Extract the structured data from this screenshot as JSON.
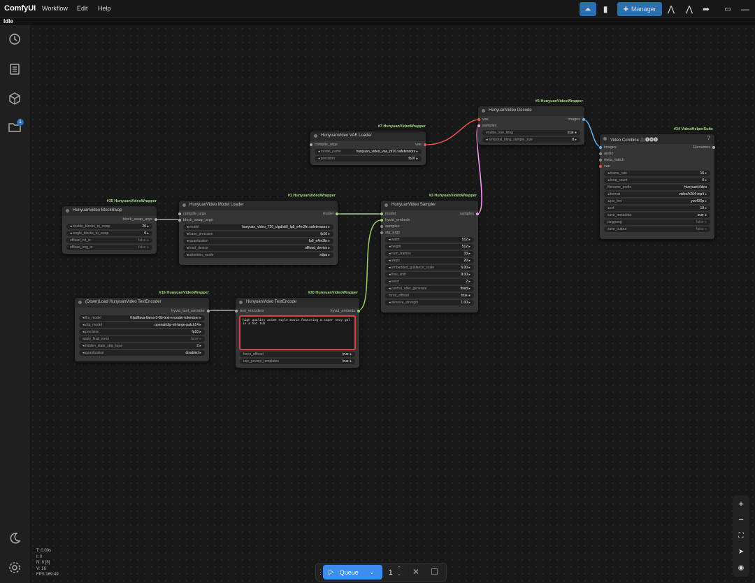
{
  "app": {
    "logo": "ComfyUI",
    "menu": [
      "Workflow",
      "Edit",
      "Help"
    ],
    "manager_label": "Manager",
    "status": "Idle"
  },
  "colors": {
    "accent": "#2a6fb0",
    "badge": "#9fdf7f",
    "highlight": "#d9413e",
    "link_model": "#a9d18e",
    "link_vae": "#ef5350",
    "link_latent": "#ff9cf9",
    "link_image": "#64b5f6",
    "link_embeds": "#9ccc65"
  },
  "icons": {
    "sidebar_top": [
      "history-icon",
      "document-icon",
      "cube-icon",
      "folder-icon"
    ],
    "sidebar_bottom": [
      "moon-icon",
      "gear-icon"
    ],
    "folder_badge": "1"
  },
  "nodes": {
    "blockswap": {
      "badge": "#35 HunyuanVideoWrapper",
      "title": "HunyuanVideo BlockSwap",
      "out": "block_swap_args",
      "widgets": [
        [
          "double_blocks_to_swap",
          "20"
        ],
        [
          "single_blocks_to_swap",
          "0"
        ]
      ],
      "toggles": [
        [
          "offload_txt_in",
          "false"
        ],
        [
          "offload_img_in",
          "false"
        ]
      ]
    },
    "modelloader": {
      "badge": "#1 HunyuanVideoWrapper",
      "title": "HunyuanVideo Model Loader",
      "inputs": [
        "compile_args",
        "block_swap_args"
      ],
      "out": "model",
      "widgets": [
        [
          "model",
          "hunyuan_video_720_cfgdistill_fp8_e4m3fn.safetensors"
        ],
        [
          "base_precision",
          "fp16"
        ],
        [
          "quantization",
          "fp8_e4m3fn"
        ],
        [
          "load_device",
          "offload_device"
        ],
        [
          "attention_mode",
          "sdpa"
        ]
      ]
    },
    "vaeloader": {
      "badge": "#7 HunyuanVideoWrapper",
      "title": "HunyuanVideo VAE Loader",
      "in": "compile_args",
      "out": "vae",
      "widgets": [
        [
          "model_name",
          "hunyuan_video_vae_bf16.safetensors"
        ],
        [
          "precision",
          "fp16"
        ]
      ]
    },
    "decode": {
      "badge": "#5 HunyuanVideoWrapper",
      "title": "HunyuanVideo Decode",
      "inputs": [
        "vae",
        "samples"
      ],
      "out": "images",
      "toggles": [
        [
          "enable_vae_tiling",
          "true"
        ]
      ],
      "widgets": [
        [
          "temporal_tiling_sample_size",
          "8"
        ]
      ]
    },
    "combine": {
      "badge": "#34 VideoHelperSuite",
      "title": "Video Combine 🎥🅥🅗🅢",
      "inputs": [
        "images",
        "audio",
        "meta_batch",
        "vae"
      ],
      "out": "Filenames",
      "widgets": [
        [
          "frame_rate",
          "16"
        ],
        [
          "loop_count",
          "0"
        ],
        [
          "filename_prefix",
          "HunyuanVideo"
        ],
        [
          "format",
          "video/h264-mp4"
        ],
        [
          "pix_fmt",
          "yuv420p"
        ],
        [
          "crf",
          "19"
        ]
      ],
      "toggles": [
        [
          "save_metadata",
          "true"
        ],
        [
          "pingpong",
          "false"
        ],
        [
          "save_output",
          "false"
        ]
      ]
    },
    "sampler": {
      "badge": "#3 HunyuanVideoWrapper",
      "title": "HunyuanVideo Sampler",
      "inputs": [
        "model",
        "hyvid_embeds",
        "samples",
        "stg_args"
      ],
      "out": "samples",
      "widgets": [
        [
          "width",
          "512"
        ],
        [
          "height",
          "512"
        ],
        [
          "num_frames",
          "33"
        ],
        [
          "steps",
          "20"
        ],
        [
          "embedded_guidance_scale",
          "6.00"
        ],
        [
          "flow_shift",
          "9.00"
        ],
        [
          "seed",
          "2"
        ],
        [
          "control_after_generate",
          "fixed"
        ]
      ],
      "toggles": [
        [
          "force_offload",
          "true"
        ]
      ],
      "widgets2": [
        [
          "denoise_strength",
          "1.00"
        ]
      ]
    },
    "textloader": {
      "badge": "#16 HunyuanVideoWrapper",
      "title": "(Down)Load HunyuanVideo TextEncoder",
      "out": "hyvid_text_encoder",
      "widgets": [
        [
          "llm_model",
          "Kijai/llava-llama-3-8b-text-encoder-tokenizer"
        ],
        [
          "clip_model",
          "openai/clip-vit-large-patch14"
        ],
        [
          "precision",
          "fp16"
        ]
      ],
      "toggles": [
        [
          "apply_final_norm",
          "false"
        ]
      ],
      "widgets2": [
        [
          "hidden_state_skip_layer",
          "2"
        ],
        [
          "quantization",
          "disabled"
        ]
      ]
    },
    "textencode": {
      "badge": "#30 HunyuanVideoWrapper",
      "title": "HunyuanVideo TextEncode",
      "in": "text_encoders",
      "out": "hyvid_embeds",
      "prompt": "high quality anime style movie featuring a super sexy gal in a hot tub",
      "toggles": [
        [
          "force_offload",
          "true"
        ],
        [
          "use_prompt_templates",
          "true"
        ]
      ]
    }
  },
  "stats": [
    "T: 0.00s",
    "I: 0",
    "N: 8 [8]",
    "V: 16",
    "FPS:169.49"
  ],
  "queue": {
    "label": "Queue",
    "count": "1"
  }
}
